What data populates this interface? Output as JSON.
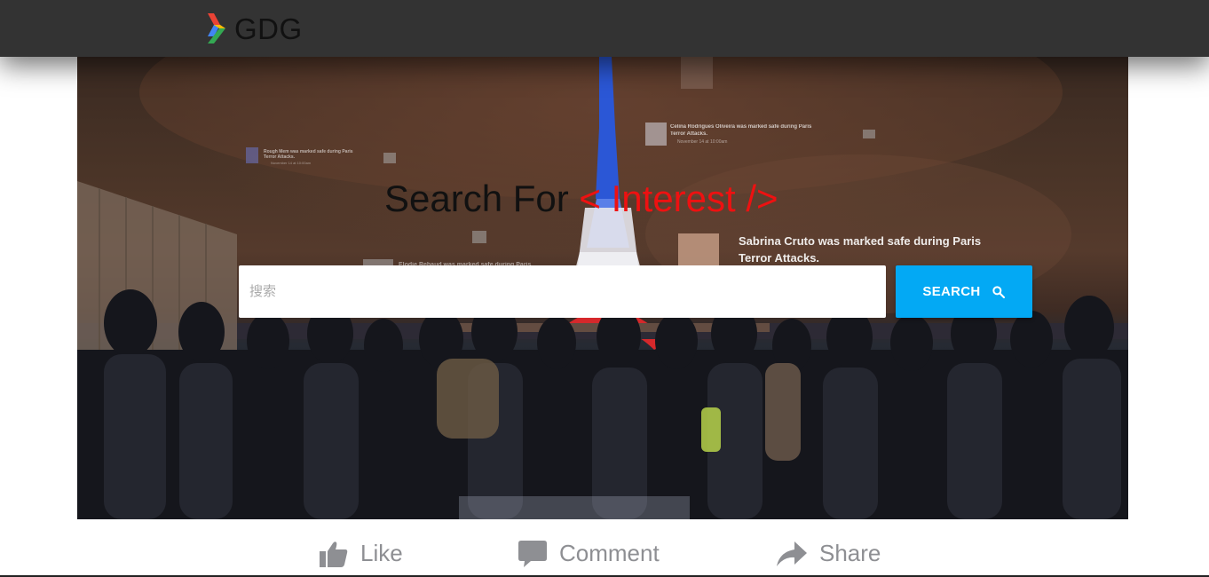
{
  "header": {
    "brand_text": "GDG",
    "logo_colors": [
      "#ea4335",
      "#4285f4",
      "#fbbc05",
      "#34a853"
    ]
  },
  "hero": {
    "title_prefix": "Search For ",
    "title_accent": "< Interest />",
    "accent_color": "#ee1111",
    "search_placeholder": "搜索",
    "search_button_label": "SEARCH",
    "search_button_color": "#03a9f4",
    "notifications": [
      {
        "text_line1": "Celina Rodrigues Oliveira was marked safe during Paris",
        "text_line2": "Terror Attacks.",
        "meta": "November 14 at 10:00am"
      },
      {
        "text_line1": "Rough Mem was marked safe during Paris",
        "text_line2": "Terror Attacks.",
        "meta": "November 14 at 10:00am"
      },
      {
        "text_line1": "Sabrina Cruto was marked safe during Paris",
        "text_line2": "Terror Attacks.",
        "meta": ""
      },
      {
        "text_line1": "Elodie Rebaud was marked safe during Paris",
        "text_line2": "",
        "meta": ""
      }
    ]
  },
  "social": {
    "like_label": "Like",
    "comment_label": "Comment",
    "share_label": "Share"
  }
}
